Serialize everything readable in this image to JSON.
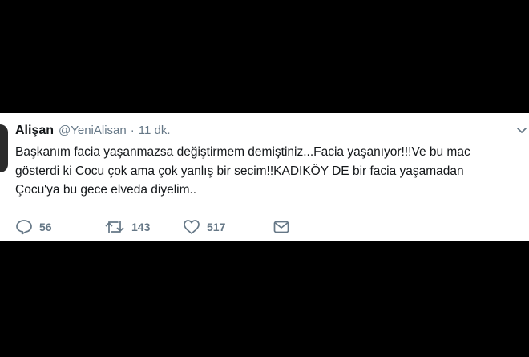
{
  "tweet": {
    "display_name": "Alişan",
    "handle": "@YeniAlisan",
    "separator": "·",
    "time": "11 dk.",
    "text_lines": [
      "Başkanım facia yaşanmazsa değiştirmem demiştiniz...Facia yaşanıyor!!!Ve bu mac",
      "gösterdi ki Cocu çok ama çok yanlış bir secim!!KADIKÖY DE bir facia yaşamadan",
      "Çocu'ya bu gece elveda diyelim.."
    ],
    "actions": {
      "replies": "56",
      "retweets": "143",
      "likes": "517"
    }
  },
  "icons": {
    "reply": "reply-icon",
    "retweet": "retweet-icon",
    "like": "heart-icon",
    "dm": "envelope-icon",
    "menu": "chevron-down-icon"
  },
  "colors": {
    "background": "#000000",
    "card": "#ffffff",
    "text": "#14171a",
    "muted": "#657786"
  }
}
